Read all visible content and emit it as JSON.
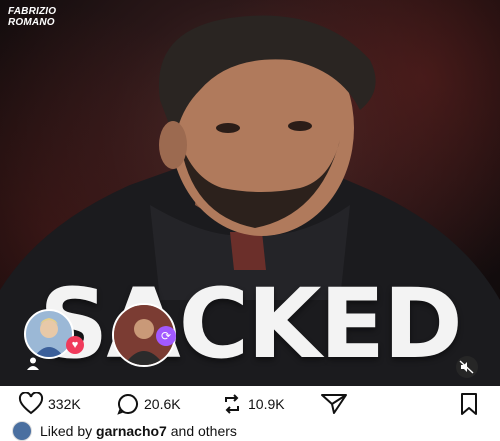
{
  "post": {
    "brand_line1": "FABRIZIO",
    "brand_line2": "ROMANO",
    "headline": "SACKED"
  },
  "actions": {
    "likes": "332K",
    "comments": "20.6K",
    "reposts": "10.9K"
  },
  "liked_by": {
    "prefix": "Liked by",
    "user": "garnacho7",
    "suffix": "and others"
  },
  "icons": [
    "heart-icon",
    "comment-icon",
    "repost-icon",
    "share-icon",
    "bookmark-icon",
    "mute-icon",
    "user-tag-icon"
  ],
  "colors": {
    "heart_badge": "#f03a5b",
    "repost_badge": "#a259ff",
    "headline": "#f3f3f3"
  }
}
